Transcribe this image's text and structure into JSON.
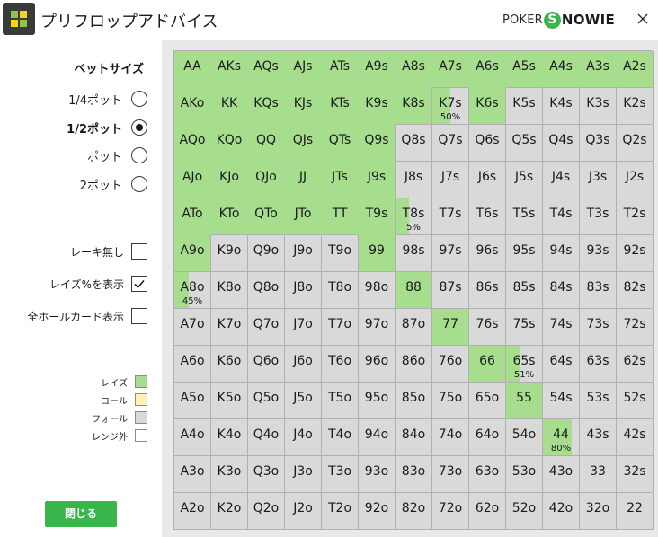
{
  "window": {
    "title": "プリフロップアドバイス",
    "logo": {
      "poker": "POKER",
      "s_letter": "S",
      "rest": "NOWIE",
      "accent": "#39b54a"
    },
    "close_icon": "close-x-icon"
  },
  "sidebar": {
    "bet_size_title": "ベットサイズ",
    "bet_options": [
      {
        "label": "1/4ポット",
        "selected": false
      },
      {
        "label": "1/2ポット",
        "selected": true
      },
      {
        "label": "ポット",
        "selected": false
      },
      {
        "label": "2ポット",
        "selected": false
      }
    ],
    "checkboxes": [
      {
        "label": "レーキ無し",
        "checked": false
      },
      {
        "label": "レイズ%を表示",
        "checked": true
      },
      {
        "label": "全ホールカード表示",
        "checked": false
      }
    ],
    "legend": [
      {
        "label": "レイズ",
        "color": "#a7de8e"
      },
      {
        "label": "コール",
        "color": "#fff2b3"
      },
      {
        "label": "フォール",
        "color": "#d9d9d9"
      },
      {
        "label": "レンジ外",
        "color": "#ffffff"
      }
    ],
    "close_button": "閉じる"
  },
  "colors": {
    "raise": "#a7de8e",
    "fold": "#d9d9d9",
    "grid_bg": "#e9e9e9"
  },
  "grid": {
    "ranks": [
      "A",
      "K",
      "Q",
      "J",
      "T",
      "9",
      "8",
      "7",
      "6",
      "5",
      "4",
      "3",
      "2"
    ],
    "pct_labels": {
      "K7s": "50%",
      "T8s": "5%",
      "A8o": "45%",
      "65s": "51%",
      "44": "80%"
    },
    "raise_fraction": {
      "AA": 1,
      "AKs": 1,
      "AQs": 1,
      "AJs": 1,
      "ATs": 1,
      "A9s": 1,
      "A8s": 1,
      "A7s": 1,
      "A6s": 1,
      "A5s": 1,
      "A4s": 1,
      "A3s": 1,
      "A2s": 1,
      "AKo": 1,
      "KK": 1,
      "KQs": 1,
      "KJs": 1,
      "KTs": 1,
      "K9s": 1,
      "K8s": 1,
      "K7s": 0.5,
      "K6s": 1,
      "AQo": 1,
      "KQo": 1,
      "QQ": 1,
      "QJs": 1,
      "QTs": 1,
      "Q9s": 1,
      "AJo": 1,
      "KJo": 1,
      "QJo": 1,
      "JJ": 1,
      "JTs": 1,
      "J9s": 1,
      "ATo": 1,
      "KTo": 1,
      "QTo": 1,
      "JTo": 1,
      "TT": 1,
      "T9s": 1,
      "T8s": 0.05,
      "A9o": 1,
      "99": 1,
      "A8o": 0.45,
      "88": 1,
      "77": 1,
      "66": 1,
      "65s": 0.51,
      "55": 1,
      "44": 0.8
    }
  }
}
